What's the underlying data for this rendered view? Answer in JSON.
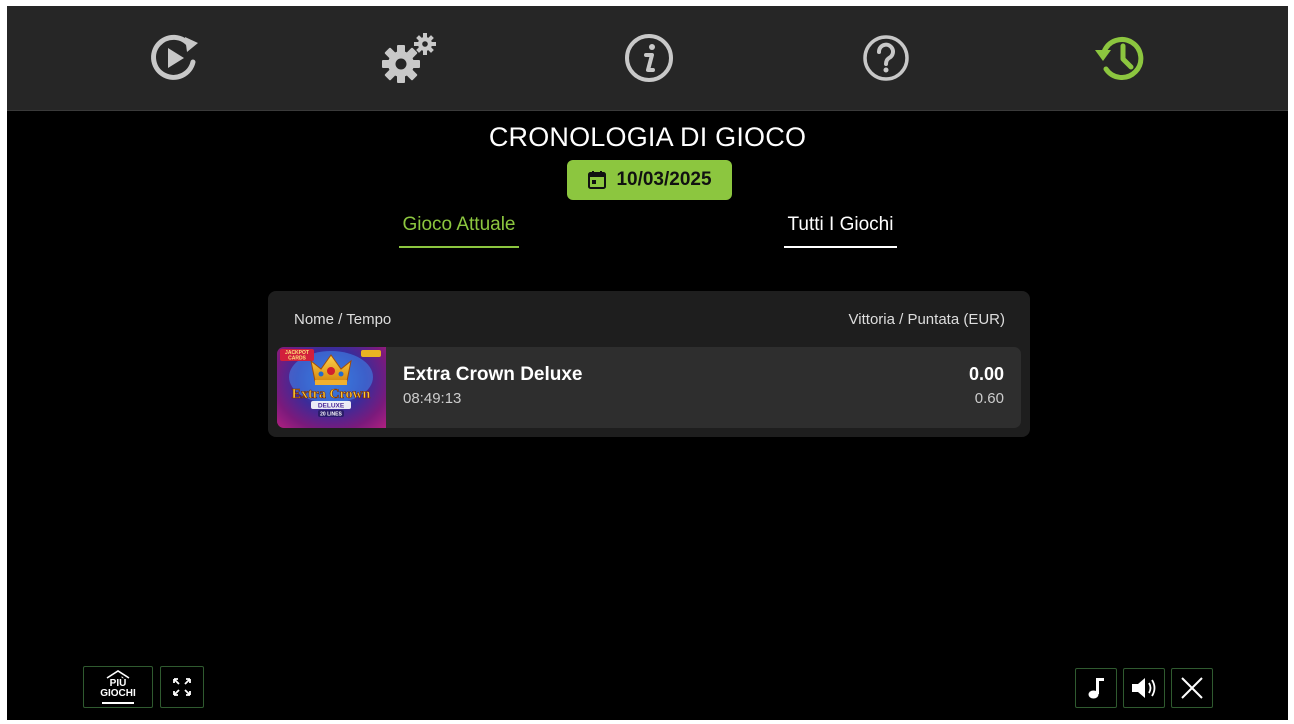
{
  "nav": {
    "items": [
      {
        "icon": "autoplay-icon",
        "active": false
      },
      {
        "icon": "settings-icon",
        "active": false
      },
      {
        "icon": "info-icon",
        "active": false
      },
      {
        "icon": "help-icon",
        "active": false
      },
      {
        "icon": "history-icon",
        "active": true
      }
    ]
  },
  "colors": {
    "accent": "#8cc63f",
    "topbar": "#262626",
    "background": "#000000",
    "panel": "#1e1e1e",
    "row": "#2e2e2e"
  },
  "page": {
    "title": "CRONOLOGIA DI GIOCO",
    "date": "10/03/2025"
  },
  "tabs": {
    "current": "Gioco Attuale",
    "all": "Tutti I Giochi"
  },
  "table": {
    "col_name": "Nome / Tempo",
    "col_win": "Vittoria / Puntata (EUR)",
    "rows": [
      {
        "name": "Extra Crown Deluxe",
        "time": "08:49:13",
        "win": "0.00",
        "bet": "0.60",
        "thumb": {
          "badge": "JACKPOT CARDS",
          "title": "Extra Crown",
          "subtitle": "DELUXE",
          "lines": "20 LINES"
        }
      }
    ]
  },
  "controls": {
    "more_games_line1": "PIÙ",
    "more_games_line2": "GIOCHI"
  }
}
